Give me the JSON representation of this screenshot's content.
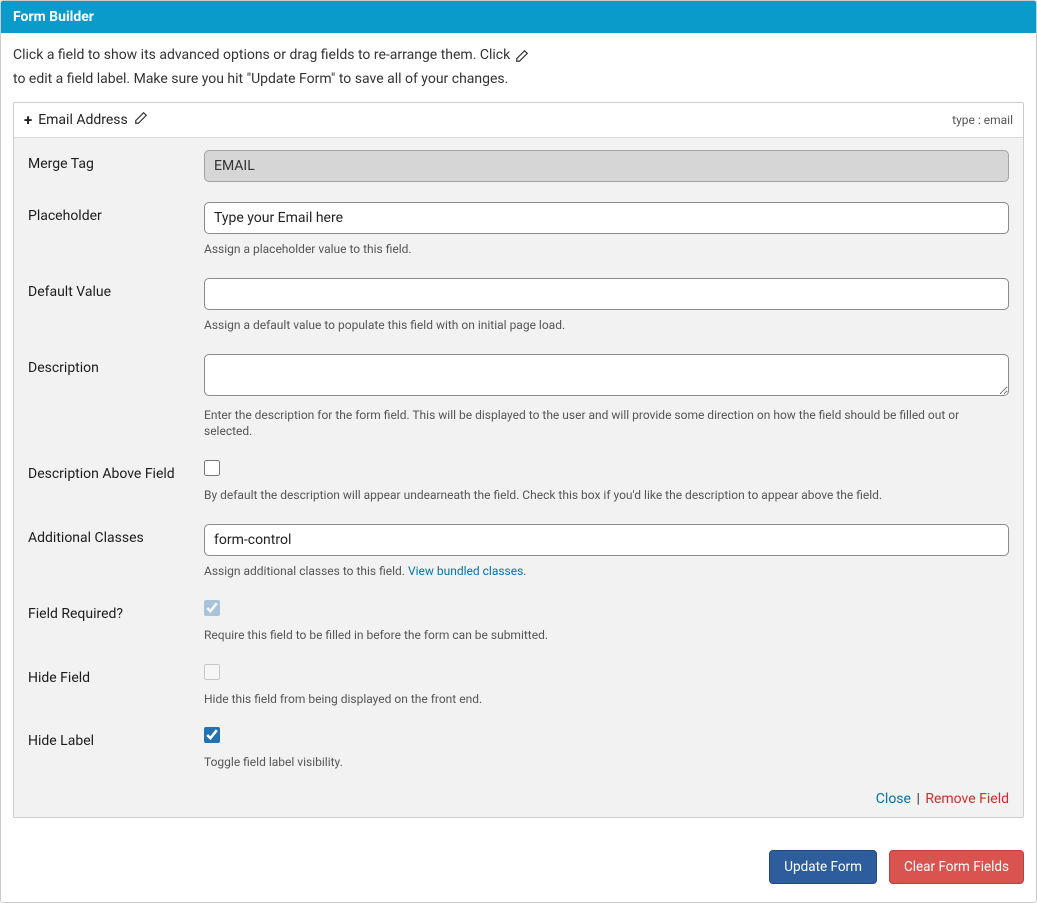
{
  "panel": {
    "title": "Form Builder"
  },
  "instructions": {
    "pre": "Click a field to show its advanced options or drag fields to re-arrange them. Click",
    "post": "to edit a field label. Make sure you hit \"Update Form\" to save all of your changes."
  },
  "field": {
    "name": "Email Address",
    "type_label": "type : email"
  },
  "rows": {
    "merge_tag": {
      "label": "Merge Tag",
      "value": "EMAIL"
    },
    "placeholder": {
      "label": "Placeholder",
      "value": "Type your Email here",
      "help": "Assign a placeholder value to this field."
    },
    "default_value": {
      "label": "Default Value",
      "value": "",
      "help": "Assign a default value to populate this field with on initial page load."
    },
    "description": {
      "label": "Description",
      "value": "",
      "help": "Enter the description for the form field. This will be displayed to the user and will provide some direction on how the field should be filled out or selected."
    },
    "description_above": {
      "label": "Description Above Field",
      "help": "By default the description will appear undearneath the field. Check this box if you'd like the description to appear above the field."
    },
    "additional_classes": {
      "label": "Additional Classes",
      "value": "form-control",
      "help_pre": "Assign additional classes to this field. ",
      "help_link": "View bundled classes",
      "help_post": "."
    },
    "required": {
      "label": "Field Required?",
      "help": "Require this field to be filled in before the form can be submitted."
    },
    "hide_field": {
      "label": "Hide Field",
      "help": "Hide this field from being displayed on the front end."
    },
    "hide_label": {
      "label": "Hide Label",
      "help": "Toggle field label visibility."
    }
  },
  "field_footer": {
    "close": "Close",
    "sep": " | ",
    "remove": "Remove Field"
  },
  "actions": {
    "update": "Update Form",
    "clear": "Clear Form Fields"
  }
}
